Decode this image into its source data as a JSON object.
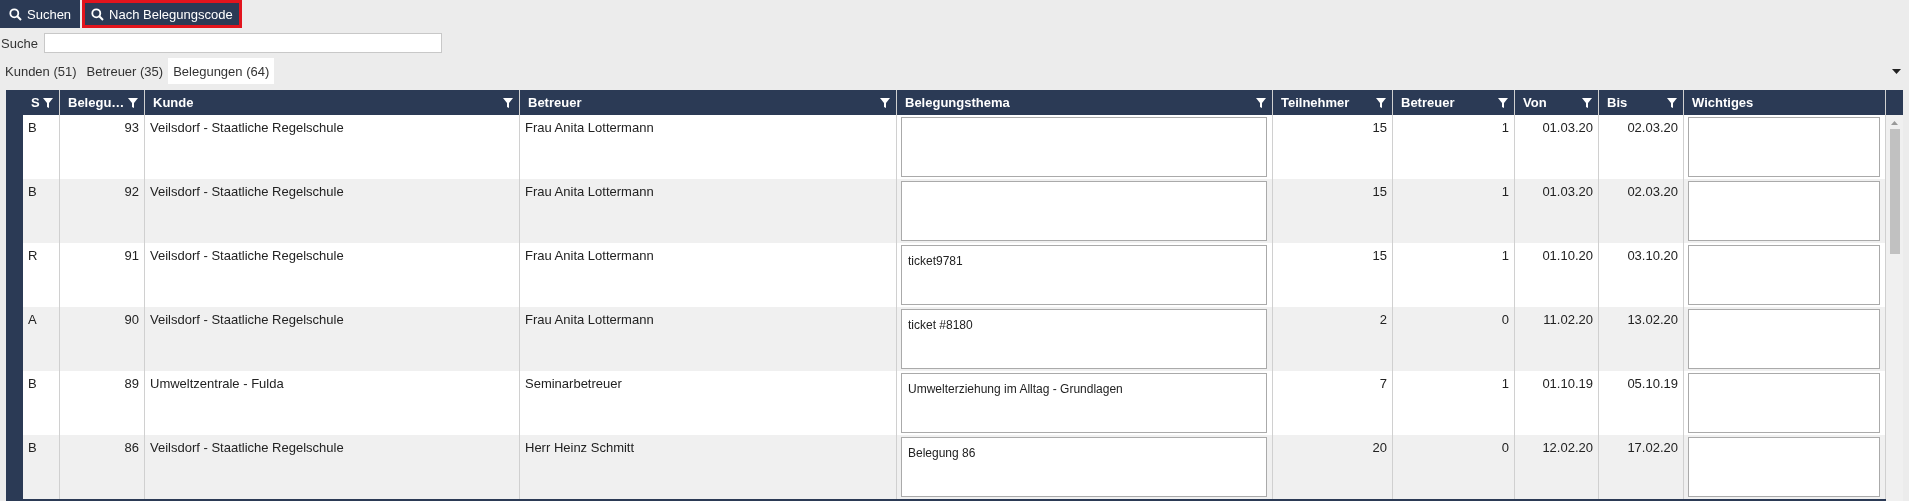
{
  "toolbar": [
    {
      "label": "Suchen",
      "selected": false
    },
    {
      "label": "Nach Belegungscode",
      "selected": true
    }
  ],
  "search": {
    "label": "Suche"
  },
  "tabs": [
    {
      "label": "Kunden (51)",
      "selected": false
    },
    {
      "label": "Betreuer (35)",
      "selected": false
    },
    {
      "label": "Belegungen (64)",
      "selected": true
    }
  ],
  "table": {
    "columns": [
      {
        "label": "S",
        "filter": true,
        "kind": "text"
      },
      {
        "label": "Belegu…",
        "filter": true,
        "kind": "number"
      },
      {
        "label": "Kunde",
        "filter": true,
        "kind": "text"
      },
      {
        "label": "Betreuer",
        "filter": true,
        "kind": "text"
      },
      {
        "label": "Belegungsthema",
        "filter": true,
        "kind": "textarea"
      },
      {
        "label": "Teilnehmer",
        "filter": true,
        "kind": "number"
      },
      {
        "label": "Betreuer",
        "filter": true,
        "kind": "number"
      },
      {
        "label": "Von",
        "filter": true,
        "kind": "number"
      },
      {
        "label": "Bis",
        "filter": true,
        "kind": "number"
      },
      {
        "label": "Wichtiges",
        "filter": false,
        "kind": "textarea"
      }
    ],
    "rows": [
      [
        "B",
        "93",
        "Veilsdorf - Staatliche Regelschule",
        "Frau Anita Lottermann",
        "",
        "15",
        "1",
        "01.03.20",
        "02.03.20",
        ""
      ],
      [
        "B",
        "92",
        "Veilsdorf - Staatliche Regelschule",
        "Frau Anita Lottermann",
        "",
        "15",
        "1",
        "01.03.20",
        "02.03.20",
        ""
      ],
      [
        "R",
        "91",
        "Veilsdorf - Staatliche Regelschule",
        "Frau Anita Lottermann",
        "ticket9781",
        "15",
        "1",
        "01.10.20",
        "03.10.20",
        ""
      ],
      [
        "A",
        "90",
        "Veilsdorf - Staatliche Regelschule",
        "Frau Anita Lottermann",
        "ticket #8180",
        "2",
        "0",
        "11.02.20",
        "13.02.20",
        ""
      ],
      [
        "B",
        "89",
        "Umweltzentrale - Fulda",
        "Seminarbetreuer",
        "Umwelterziehung im Alltag - Grundlagen",
        "7",
        "1",
        "01.10.19",
        "05.10.19",
        ""
      ],
      [
        "B",
        "86",
        "Veilsdorf - Staatliche Regelschule",
        "Herr Heinz Schmitt",
        "Belegung 86",
        "20",
        "0",
        "12.02.20",
        "17.02.20",
        ""
      ]
    ]
  }
}
